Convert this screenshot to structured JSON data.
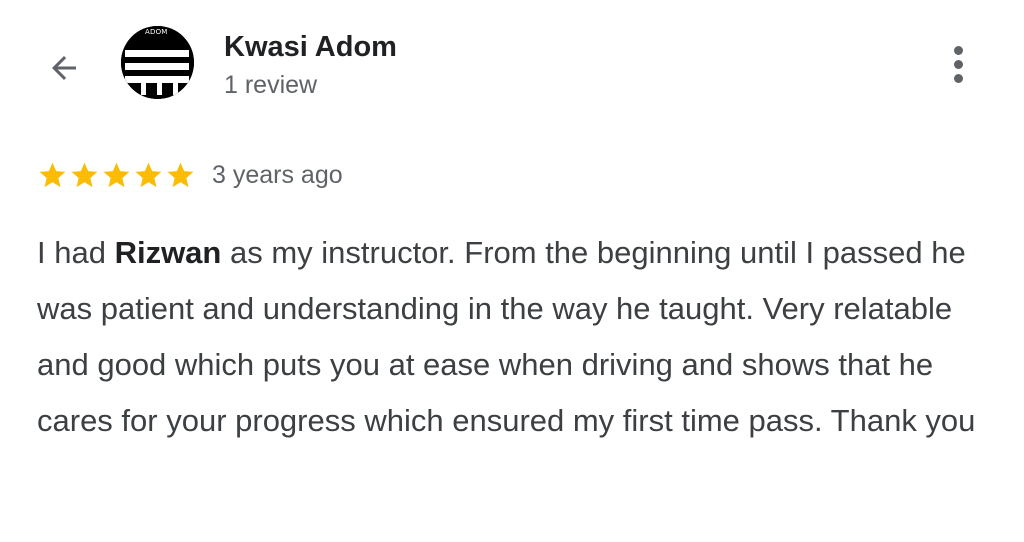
{
  "header": {
    "reviewer_name": "Kwasi Adom",
    "review_count": "1 review",
    "avatar_logo_text": "ADOM",
    "back_icon": "arrow-back-icon",
    "more_icon": "more-vertical-icon"
  },
  "review": {
    "rating": 5,
    "max_rating": 5,
    "star_color": "#fbbc04",
    "time": "3 years ago",
    "text_before": "I had ",
    "text_bold": "Rizwan",
    "text_after": " as my instructor. From the beginning until I passed he was patient and understanding in the way he taught. Very relatable and good which puts you at ease when driving and shows that he cares for your progress which ensured my first time pass. Thank you"
  }
}
